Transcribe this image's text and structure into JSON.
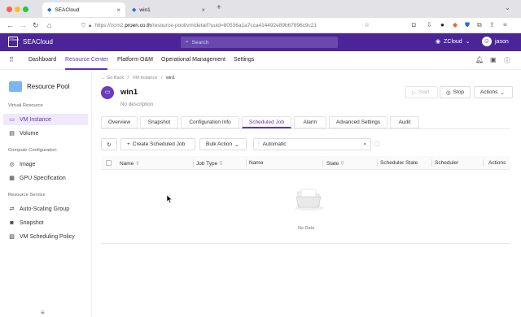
{
  "browser": {
    "tabs": [
      {
        "title": "SEACloud"
      },
      {
        "title": "win1"
      }
    ],
    "url_prefix": "https://zcm2.",
    "url_domain": "proen.co.th",
    "url_rest": "/resource-pool/vm/detail?uuid=80536a1a7cca414492e89b67896c9c21"
  },
  "header": {
    "brand": "SEACloud",
    "brand_logo": "ZStack",
    "search_placeholder": "Search",
    "zone": "ZCloud",
    "user": "jason"
  },
  "nav": {
    "items": [
      "Dashboard",
      "Resource Center",
      "Platform O&M",
      "Operational Management",
      "Settings"
    ],
    "active": "Resource Center"
  },
  "sidebar": {
    "title": "Resource Pool",
    "groups": [
      {
        "label": "Virtual Resource",
        "items": [
          {
            "label": "VM Instance",
            "icon": "monitor-icon",
            "active": true
          },
          {
            "label": "Volume",
            "icon": "volume-icon"
          }
        ]
      },
      {
        "label": "Compute Configuration",
        "items": [
          {
            "label": "Image",
            "icon": "disc-icon"
          },
          {
            "label": "GPU Specification",
            "icon": "gpu-icon"
          }
        ]
      },
      {
        "label": "Resource Service",
        "items": [
          {
            "label": "Auto-Scaling Group",
            "icon": "scaling-icon"
          },
          {
            "label": "Snapshot",
            "icon": "camera-icon"
          },
          {
            "label": "VM Scheduling Policy",
            "icon": "policy-icon"
          }
        ]
      }
    ]
  },
  "breadcrumb": {
    "back": "Go Back",
    "parent": "VM Instance",
    "current": "win1"
  },
  "vm": {
    "name": "win1",
    "description": "No description"
  },
  "actions": {
    "start": "Start",
    "stop": "Stop",
    "more": "Actions"
  },
  "tabs": [
    "Overview",
    "Snapshot",
    "Configuration Info",
    "Scheduled Job",
    "Alarm",
    "Advanced Settings",
    "Audit"
  ],
  "active_tab": "Scheduled Job",
  "toolbar": {
    "create": "Create Scheduled Job",
    "bulk": "Bulk Action",
    "filter_value": "Automatic"
  },
  "table": {
    "columns": [
      "Name",
      "Job Type",
      "Name",
      "State",
      "Scheduler State",
      "Scheduler",
      "Actions"
    ],
    "empty_text": "No Data"
  },
  "colors": {
    "brand": "#4b2597",
    "accent": "#5c36b3"
  }
}
